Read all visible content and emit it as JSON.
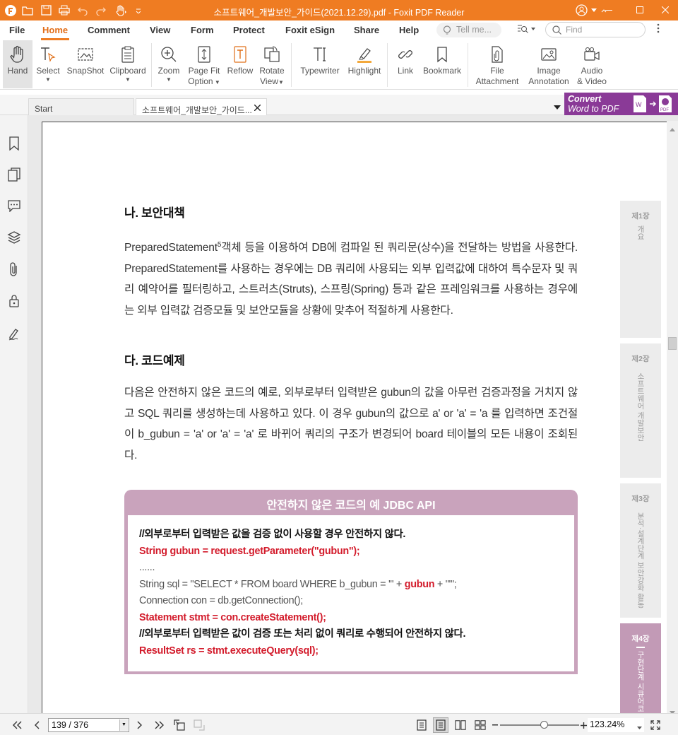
{
  "window": {
    "title": "소프트웨어_개발보안_가이드(2021.12.29).pdf - Foxit PDF Reader"
  },
  "menu": {
    "items": [
      "File",
      "Home",
      "Comment",
      "View",
      "Form",
      "Protect",
      "Foxit eSign",
      "Share",
      "Help"
    ],
    "active": "Home",
    "tell_me": "Tell me...",
    "find": "Find"
  },
  "ribbon": {
    "hand": "Hand",
    "select": "Select",
    "snapshot": "SnapShot",
    "clipboard": "Clipboard",
    "zoom": "Zoom",
    "page_fit_1": "Page Fit",
    "page_fit_2": "Option",
    "reflow": "Reflow",
    "rotate_1": "Rotate",
    "rotate_2": "View",
    "typewriter": "Typewriter",
    "highlight": "Highlight",
    "link": "Link",
    "bookmark": "Bookmark",
    "file_att_1": "File",
    "file_att_2": "Attachment",
    "image_ann_1": "Image",
    "image_ann_2": "Annotation",
    "audio_1": "Audio",
    "audio_2": "& Video"
  },
  "tabs": {
    "start": "Start",
    "doc": "소프트웨어_개발보안_가이드..."
  },
  "convert": {
    "line1": "Convert",
    "line2": "Word to PDF"
  },
  "doc": {
    "heading1": "나. 보안대책",
    "para1_a": "PreparedStatement",
    "para1_sup": "5",
    "para1_b": "객체 등을 이용하여 DB에 컴파일 된 쿼리문(상수)을 전달하는 방법을 사용한다. PreparedStatement를 사용하는 경우에는 DB 쿼리에 사용되는 외부 입력값에 대하여 특수문자 및 쿼리 예약어를 필터링하고, 스트러츠(Struts), 스프링(Spring) 등과 같은 프레임워크를 사용하는 경우에는 외부 입력값 검증모듈 및 보안모듈을 상황에 맞추어 적절하게 사용한다.",
    "heading2": "다. 코드예제",
    "para2": "다음은 안전하지 않은 코드의 예로, 외부로부터 입력받은 gubun의 값을 아무런 검증과정을 거치지 않고 SQL 쿼리를 생성하는데 사용하고 있다. 이 경우 gubun의 값으로 a' or 'a' = 'a 를 입력하면 조건절이 b_gubun = 'a' or 'a' = 'a' 로 바뀌어 쿼리의 구조가 변경되어 board 테이블의 모든 내용이 조회된다.",
    "code_title": "안전하지 않은 코드의 예 JDBC API",
    "code": {
      "l1": "//외부로부터 입력받은 값을 검증 없이 사용할 경우 안전하지 않다.",
      "l2": "String gubun = request.getParameter(\"gubun\");",
      "l3": "......",
      "l4a": "String sql = \"SELECT * FROM board WHERE b_gubun = '\" + ",
      "l4b": "gubun",
      "l4c": " + \"'\";",
      "l5": "Connection con = db.getConnection();",
      "l6": "Statement stmt = con.createStatement();",
      "l7": "//외부로부터 입력받은 값이 검증 또는 처리 없이 쿼리로 수행되어 안전하지 않다.",
      "l8": "ResultSet rs = stmt.executeQuery(sql);"
    },
    "chapters": [
      {
        "num": "제1장",
        "name": "개요"
      },
      {
        "num": "제2장",
        "name": "소프트웨어 개발보안"
      },
      {
        "num": "제3장",
        "name": "분석·설계단계 보안강화 활동"
      },
      {
        "num": "제4장",
        "name": "구현단계 시큐어코"
      }
    ]
  },
  "status": {
    "page": "139 / 376",
    "zoom": "123.24%",
    "zoom_level_fraction": 0.55
  }
}
